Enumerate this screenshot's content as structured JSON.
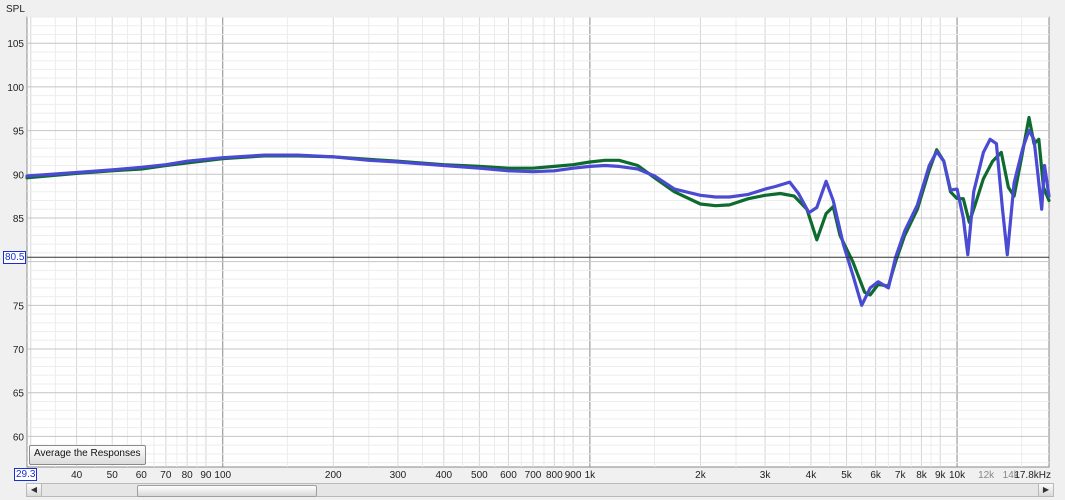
{
  "chart_data": {
    "type": "line",
    "ylabel": "SPL",
    "xscale": "log",
    "xlim": [
      29.3,
      17800
    ],
    "ylim": [
      56.5,
      108
    ],
    "grid": true,
    "y_ticks": [
      105,
      100,
      95,
      90,
      85,
      75,
      70,
      65,
      60
    ],
    "x_ticks": [
      {
        "value": 40,
        "label": "40"
      },
      {
        "value": 50,
        "label": "50"
      },
      {
        "value": 60,
        "label": "60"
      },
      {
        "value": 70,
        "label": "70"
      },
      {
        "value": 80,
        "label": "80"
      },
      {
        "value": 90,
        "label": "90"
      },
      {
        "value": 100,
        "label": "100"
      },
      {
        "value": 200,
        "label": "200"
      },
      {
        "value": 300,
        "label": "300"
      },
      {
        "value": 400,
        "label": "400"
      },
      {
        "value": 500,
        "label": "500"
      },
      {
        "value": 600,
        "label": "600"
      },
      {
        "value": 700,
        "label": "700"
      },
      {
        "value": 800,
        "label": "800"
      },
      {
        "value": 900,
        "label": "900"
      },
      {
        "value": 1000,
        "label": "1k"
      },
      {
        "value": 2000,
        "label": "2k"
      },
      {
        "value": 3000,
        "label": "3k"
      },
      {
        "value": 4000,
        "label": "4k"
      },
      {
        "value": 5000,
        "label": "5k"
      },
      {
        "value": 6000,
        "label": "6k"
      },
      {
        "value": 7000,
        "label": "7k"
      },
      {
        "value": 8000,
        "label": "8k"
      },
      {
        "value": 9000,
        "label": "9k"
      },
      {
        "value": 10000,
        "label": "10k"
      },
      {
        "value": 12000,
        "label": "12k",
        "dim": true
      },
      {
        "value": 14000,
        "label": "14k",
        "dim": true
      }
    ],
    "x_end_label": "17.8kHz",
    "x_start_label": "29.3",
    "cursor": {
      "value": 80.5,
      "label": "80.5"
    },
    "series": [
      {
        "color": "#0d6b2e",
        "points": [
          [
            29.3,
            89.6
          ],
          [
            40,
            90.1
          ],
          [
            50,
            90.4
          ],
          [
            60,
            90.6
          ],
          [
            70,
            91.0
          ],
          [
            80,
            91.3
          ],
          [
            100,
            91.8
          ],
          [
            130,
            92.1
          ],
          [
            160,
            92.1
          ],
          [
            200,
            92.0
          ],
          [
            250,
            91.7
          ],
          [
            300,
            91.5
          ],
          [
            400,
            91.1
          ],
          [
            500,
            90.9
          ],
          [
            600,
            90.7
          ],
          [
            700,
            90.7
          ],
          [
            800,
            90.9
          ],
          [
            900,
            91.1
          ],
          [
            1000,
            91.4
          ],
          [
            1100,
            91.6
          ],
          [
            1200,
            91.6
          ],
          [
            1350,
            91.0
          ],
          [
            1500,
            89.6
          ],
          [
            1700,
            88.0
          ],
          [
            2000,
            86.6
          ],
          [
            2200,
            86.4
          ],
          [
            2400,
            86.5
          ],
          [
            2700,
            87.2
          ],
          [
            3000,
            87.6
          ],
          [
            3300,
            87.8
          ],
          [
            3600,
            87.5
          ],
          [
            3900,
            86.0
          ],
          [
            4150,
            82.5
          ],
          [
            4400,
            85.5
          ],
          [
            4600,
            86.3
          ],
          [
            4800,
            83.0
          ],
          [
            5200,
            80.0
          ],
          [
            5600,
            76.5
          ],
          [
            5800,
            76.2
          ],
          [
            6100,
            77.4
          ],
          [
            6500,
            77.2
          ],
          [
            6800,
            80.0
          ],
          [
            7200,
            83.0
          ],
          [
            7800,
            86.0
          ],
          [
            8400,
            90.5
          ],
          [
            8800,
            92.8
          ],
          [
            9200,
            91.5
          ],
          [
            9600,
            88.0
          ],
          [
            10000,
            87.2
          ],
          [
            10400,
            87.2
          ],
          [
            10800,
            84.5
          ],
          [
            11200,
            86.5
          ],
          [
            11800,
            89.5
          ],
          [
            12500,
            91.5
          ],
          [
            13200,
            92.5
          ],
          [
            13800,
            88.5
          ],
          [
            14300,
            87.5
          ],
          [
            15000,
            92.0
          ],
          [
            15700,
            96.5
          ],
          [
            16200,
            93.5
          ],
          [
            16700,
            94.0
          ],
          [
            17200,
            88.5
          ],
          [
            17800,
            87.0
          ]
        ]
      },
      {
        "color": "#4a4ad2",
        "points": [
          [
            29.3,
            89.8
          ],
          [
            40,
            90.2
          ],
          [
            50,
            90.5
          ],
          [
            60,
            90.8
          ],
          [
            70,
            91.1
          ],
          [
            80,
            91.5
          ],
          [
            100,
            91.9
          ],
          [
            130,
            92.2
          ],
          [
            160,
            92.2
          ],
          [
            200,
            92.0
          ],
          [
            250,
            91.6
          ],
          [
            300,
            91.4
          ],
          [
            400,
            91.0
          ],
          [
            500,
            90.7
          ],
          [
            600,
            90.4
          ],
          [
            700,
            90.3
          ],
          [
            800,
            90.4
          ],
          [
            900,
            90.7
          ],
          [
            1000,
            90.9
          ],
          [
            1100,
            91.0
          ],
          [
            1200,
            90.9
          ],
          [
            1350,
            90.6
          ],
          [
            1500,
            89.8
          ],
          [
            1700,
            88.3
          ],
          [
            2000,
            87.6
          ],
          [
            2200,
            87.4
          ],
          [
            2400,
            87.4
          ],
          [
            2700,
            87.7
          ],
          [
            3000,
            88.3
          ],
          [
            3200,
            88.6
          ],
          [
            3500,
            89.1
          ],
          [
            3700,
            87.8
          ],
          [
            3950,
            85.6
          ],
          [
            4150,
            86.2
          ],
          [
            4400,
            89.2
          ],
          [
            4600,
            87.0
          ],
          [
            4900,
            82.0
          ],
          [
            5200,
            78.5
          ],
          [
            5500,
            75.0
          ],
          [
            5800,
            77.0
          ],
          [
            6100,
            77.7
          ],
          [
            6500,
            77.0
          ],
          [
            6800,
            80.5
          ],
          [
            7200,
            83.5
          ],
          [
            7800,
            86.5
          ],
          [
            8400,
            91.0
          ],
          [
            8800,
            92.6
          ],
          [
            9200,
            91.5
          ],
          [
            9600,
            88.2
          ],
          [
            10000,
            88.3
          ],
          [
            10400,
            85.0
          ],
          [
            10700,
            80.8
          ],
          [
            11100,
            88.0
          ],
          [
            11800,
            92.5
          ],
          [
            12300,
            94.0
          ],
          [
            12800,
            93.5
          ],
          [
            13300,
            86.0
          ],
          [
            13700,
            80.8
          ],
          [
            14300,
            89.0
          ],
          [
            15100,
            93.0
          ],
          [
            15700,
            95.0
          ],
          [
            16200,
            94.0
          ],
          [
            16600,
            90.0
          ],
          [
            17000,
            86.0
          ],
          [
            17300,
            91.0
          ],
          [
            17800,
            87.5
          ]
        ]
      }
    ]
  },
  "button": {
    "label": "Average the Responses"
  },
  "scrollbar": {
    "left": "◀",
    "right": "▶"
  }
}
